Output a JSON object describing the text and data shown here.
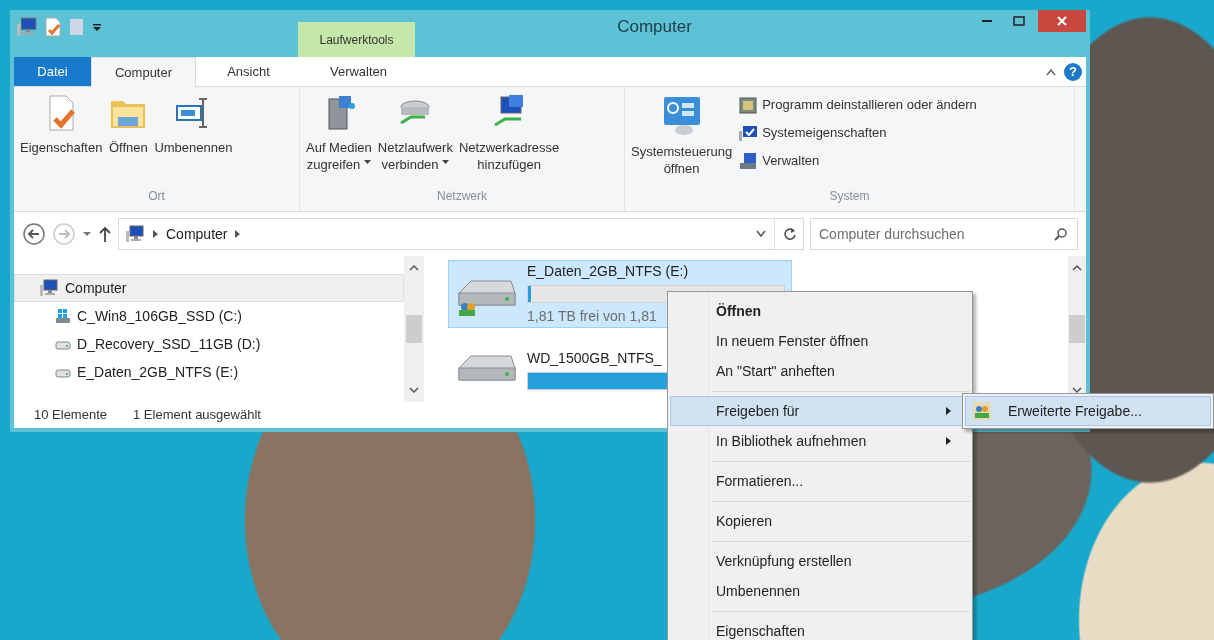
{
  "window": {
    "title": "Computer",
    "contextual_group": "Laufwerktools"
  },
  "tabs": [
    {
      "label": "Datei",
      "kind": "file",
      "selected": false
    },
    {
      "label": "Computer",
      "kind": "tab",
      "selected": true
    },
    {
      "label": "Ansicht",
      "kind": "tab",
      "selected": false
    },
    {
      "label": "Verwalten",
      "kind": "contextual",
      "selected": false
    }
  ],
  "help": "?",
  "ribbon": {
    "groups": [
      {
        "label": "Ort",
        "buttons": [
          {
            "lines": [
              "Eigenschaften"
            ],
            "dropdown": false
          },
          {
            "lines": [
              "Öffnen"
            ],
            "dropdown": false
          },
          {
            "lines": [
              "Umbenennen"
            ],
            "dropdown": false
          }
        ]
      },
      {
        "label": "Netzwerk",
        "buttons": [
          {
            "lines": [
              "Auf Medien",
              "zugreifen"
            ],
            "dropdown": true
          },
          {
            "lines": [
              "Netzlaufwerk",
              "verbinden"
            ],
            "dropdown": true
          },
          {
            "lines": [
              "Netzwerkadresse",
              "hinzufügen"
            ],
            "dropdown": false
          }
        ]
      },
      {
        "label": "System",
        "buttons": [
          {
            "lines": [
              "Systemsteuerung",
              "öffnen"
            ],
            "dropdown": false
          }
        ],
        "small_buttons": [
          {
            "label": "Programm deinstallieren oder ändern"
          },
          {
            "label": "Systemeigenschaften"
          },
          {
            "label": "Verwalten"
          }
        ]
      }
    ]
  },
  "address": {
    "crumbs": [
      "Computer"
    ]
  },
  "search": {
    "placeholder": "Computer durchsuchen"
  },
  "nav_tree": [
    {
      "label": "Computer",
      "selected": true,
      "children": [
        {
          "label": "C_Win8_106GB_SSD (C:)",
          "selected": false
        },
        {
          "label": "D_Recovery_SSD_11GB (D:)",
          "selected": false
        },
        {
          "label": "E_Daten_2GB_NTFS (E:)",
          "selected": false
        }
      ]
    }
  ],
  "drives": [
    {
      "name": "E_Daten_2GB_NTFS (E:)",
      "level": 0.01,
      "free": "1,81 TB frei von 1,81",
      "selected": true,
      "shared": true
    },
    {
      "name": "WD_1500GB_NTFS_",
      "level": 0.55,
      "selected": false,
      "shared": false
    }
  ],
  "status_bar": {
    "count": "10 Elemente",
    "selection": "1 Element ausgewählt"
  },
  "context_menu": {
    "groups": [
      [
        {
          "label": "Öffnen",
          "default": true,
          "submenu": false,
          "selected": false
        },
        {
          "label": "In neuem Fenster öffnen",
          "default": false,
          "submenu": false,
          "selected": false
        },
        {
          "label": "An \"Start\" anheften",
          "default": false,
          "submenu": false,
          "selected": false
        }
      ],
      [
        {
          "label": "Freigeben für",
          "default": false,
          "submenu": true,
          "selected": true
        },
        {
          "label": "In Bibliothek aufnehmen",
          "default": false,
          "submenu": true,
          "selected": false
        }
      ],
      [
        {
          "label": "Formatieren...",
          "default": false,
          "submenu": false,
          "selected": false
        }
      ],
      [
        {
          "label": "Kopieren",
          "default": false,
          "submenu": false,
          "selected": false
        }
      ],
      [
        {
          "label": "Verknüpfung erstellen",
          "default": false,
          "submenu": false,
          "selected": false
        },
        {
          "label": "Umbenennen",
          "default": false,
          "submenu": false,
          "selected": false
        }
      ],
      [
        {
          "label": "Eigenschaften",
          "default": false,
          "submenu": false,
          "selected": false
        }
      ]
    ]
  },
  "submenu": {
    "items": [
      {
        "label": "Erweiterte Freigabe...",
        "selected": true
      }
    ]
  }
}
